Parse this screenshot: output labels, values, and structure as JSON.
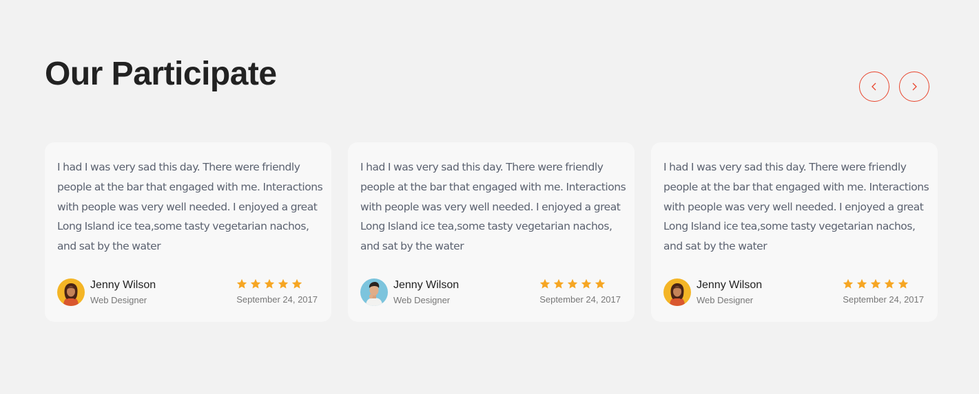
{
  "section": {
    "title": "Our Participate",
    "accent_color": "#e8452d",
    "star_color": "#f6a623"
  },
  "nav": {
    "prev_icon": "chevron-left-icon",
    "next_icon": "chevron-right-icon"
  },
  "testimonials": [
    {
      "text": "I had I was very sad this day. There were friendly people at the bar that engaged with me. Interactions with people was very well needed. I enjoyed a great Long Island ice tea,some tasty vegetarian nachos, and sat by the water",
      "name": "Jenny Wilson",
      "role": "Web Designer",
      "date": "September 24, 2017",
      "rating": 5,
      "avatar": "woman-avatar"
    },
    {
      "text": "I had I was very sad this day. There were friendly people at the bar that engaged with me. Interactions with people was very well needed. I enjoyed a great Long Island ice tea,some tasty vegetarian nachos, and sat by the water",
      "name": "Jenny Wilson",
      "role": "Web Designer",
      "date": "September 24, 2017",
      "rating": 5,
      "avatar": "man-avatar"
    },
    {
      "text": "I had I was very sad this day. There were friendly people at the bar that engaged with me. Interactions with people was very well needed. I enjoyed a great Long Island ice tea,some tasty vegetarian nachos, and sat by the water",
      "name": "Jenny Wilson",
      "role": "Web Designer",
      "date": "September 24, 2017",
      "rating": 5,
      "avatar": "woman-avatar"
    }
  ]
}
